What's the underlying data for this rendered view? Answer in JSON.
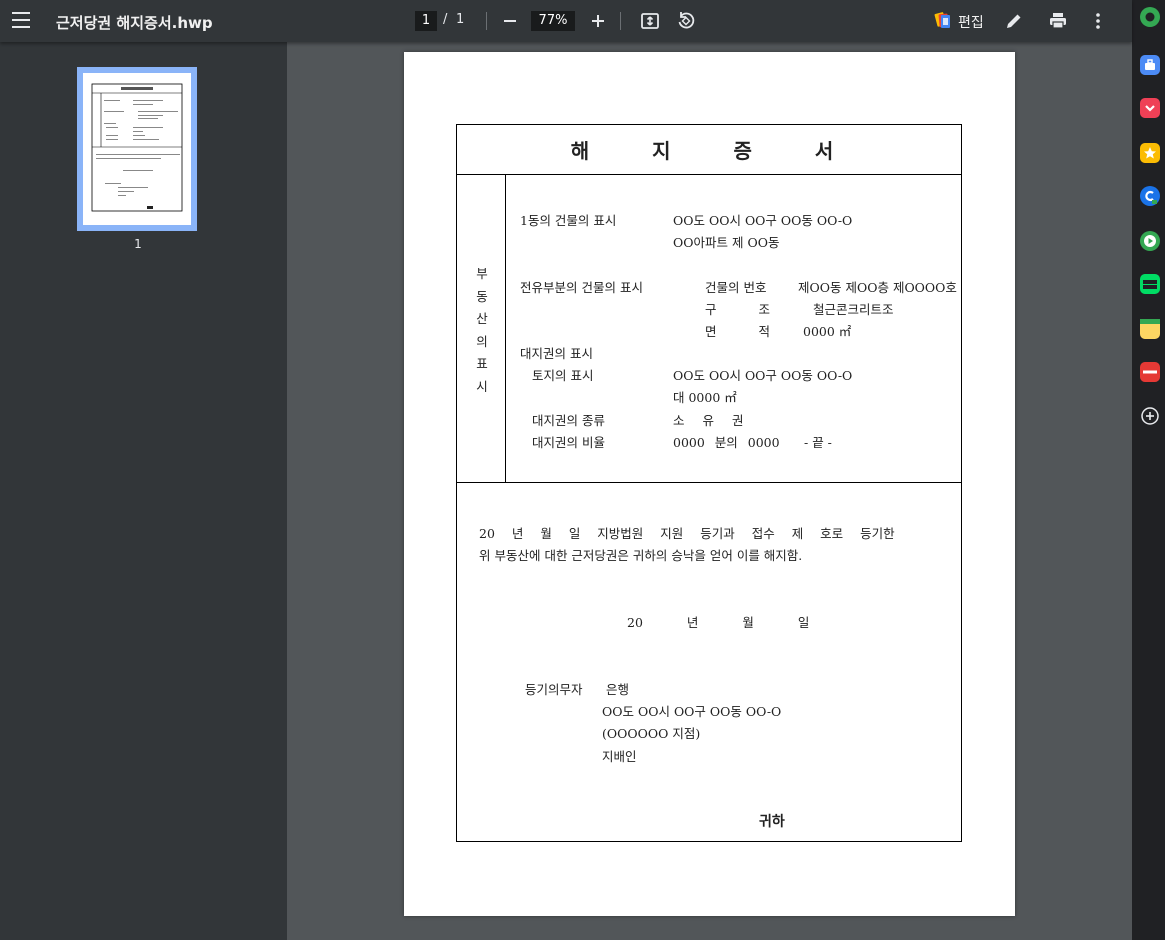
{
  "toolbar": {
    "title": "근저당권 해지증서.hwp",
    "page_current": "1",
    "page_separator": "/",
    "page_total": "1",
    "zoom": "77%",
    "edit_label": "편집",
    "icons": {
      "menu": "hamburger-menu-icon",
      "zoom_out": "minus-icon",
      "zoom_in": "plus-icon",
      "fit": "fit-to-page-icon",
      "rotate": "rotate-icon",
      "edit_app": "edit-app-logo",
      "pencil": "pencil-icon",
      "print": "print-icon",
      "more": "more-vertical-icon"
    }
  },
  "sidebar": {
    "thumbnail_page_number": "1"
  },
  "document": {
    "heading": "해 지 증 서",
    "vertical_label": [
      "부",
      "동",
      "산",
      "의",
      "표",
      "시"
    ],
    "building_label": "1동의 건물의 표시",
    "building_address": "OO도 OO시 OO구 OO동 OO-O",
    "building_name": "OO아파트 제 OO동",
    "unit_label": "전유부분의 건물의 표시",
    "unit_number_label": "건물의 번호",
    "unit_number_value": "제OO동 제OO층 제OOOO호",
    "structure_label": "구 조",
    "structure_value": "철근콘크리트조",
    "area_label": "면 적",
    "area_value": "0000 ㎡",
    "land_right_label": "대지권의 표시",
    "land_label": "토지의 표시",
    "land_address": "OO도 OO시 OO구 OO동 OO-O",
    "land_area": "대 0000 ㎡",
    "right_type_label": "대지권의 종류",
    "right_type_value": "소 유 권",
    "right_ratio_label": "대지권의 비율",
    "right_ratio_value": "0000 분의 0000",
    "end_mark": "- 끝 -",
    "statement_line1": "20 년 월 일 지방법원 지원 등기과 접수 제 호로 등기한",
    "statement_line2": "위 부동산에 대한 근저당권은 귀하의 승낙을 얻어 이를 해지함.",
    "date_line": "20 년 월 일",
    "obligor_label": "등기의무자",
    "obligor_bank": "은행",
    "obligor_address": "OO도 OO시 OO구 OO동 OO-O",
    "obligor_branch": "(OOOOOO 지점)",
    "obligor_manager": "지배인",
    "signoff": "귀하"
  },
  "extensions": [
    {
      "name": "green-circle-icon",
      "color": "#34a853"
    },
    {
      "name": "briefcase-icon",
      "color": "#4c8bf5"
    },
    {
      "name": "pocket-icon",
      "color": "#ef4056"
    },
    {
      "name": "star-icon",
      "color": "#fbbc04"
    },
    {
      "name": "chat-c-icon",
      "color": "#1a73e8"
    },
    {
      "name": "play-circle-icon",
      "color": "#34a853"
    },
    {
      "name": "webtoon-icon",
      "color": "#00dc64"
    },
    {
      "name": "notes-icon",
      "color": "#fdd663"
    },
    {
      "name": "now-icon",
      "color": "#e53935"
    },
    {
      "name": "add-extension-icon",
      "color": "#e8eaed"
    }
  ]
}
